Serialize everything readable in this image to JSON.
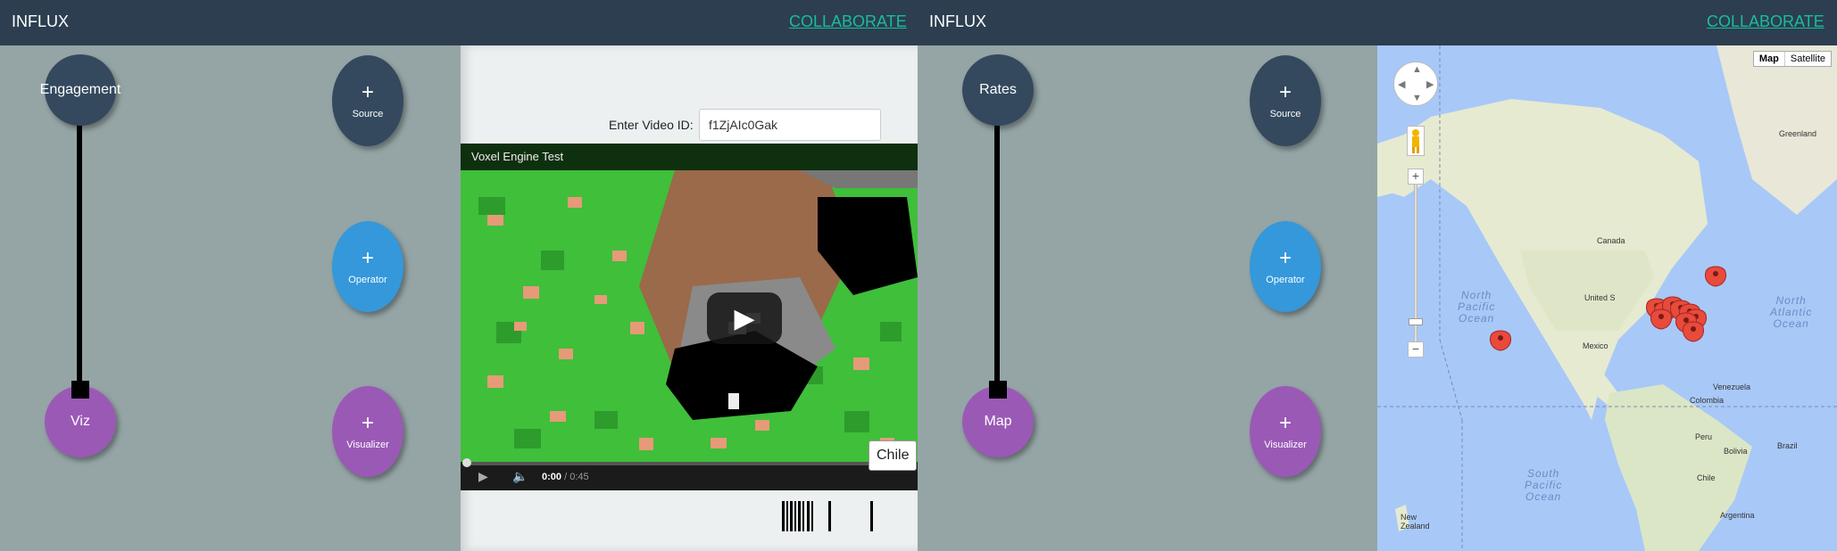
{
  "left_app": {
    "brand": "INFLUX",
    "collaborate": "COLLABORATE",
    "nodes": {
      "source": "Engagement",
      "viz": "Viz"
    },
    "add_buttons": {
      "plus": "+",
      "source": "Source",
      "operator": "Operator",
      "visualizer": "Visualizer"
    },
    "video_panel": {
      "label": "Enter Video ID:",
      "video_id": "f1ZjAIc0Gak",
      "title": "Voxel Engine Test",
      "time_current": "0:00",
      "time_total": " / 0:45",
      "tooltip": "Chile"
    }
  },
  "right_app": {
    "brand": "INFLUX",
    "collaborate": "COLLABORATE",
    "nodes": {
      "source": "Rates",
      "viz": "Map"
    },
    "add_buttons": {
      "plus": "+",
      "source": "Source",
      "operator": "Operator",
      "visualizer": "Visualizer"
    },
    "map": {
      "map_type": [
        "Map",
        "Satellite"
      ],
      "zoom_in": "+",
      "zoom_out": "−",
      "oceans": [
        {
          "name": "North Pacific Ocean",
          "lines": [
            "North",
            "Pacific",
            "Ocean"
          ]
        },
        {
          "name": "North Atlantic Ocean",
          "lines": [
            "North",
            "Atlantic",
            "Ocean"
          ]
        },
        {
          "name": "South Pacific Ocean",
          "lines": [
            "South",
            "Pacific",
            "Ocean"
          ]
        }
      ],
      "places": [
        "Greenland",
        "Canada",
        "United S",
        "Mexico",
        "Venezuela",
        "Colombia",
        "Peru",
        "Bolivia",
        "Brazil",
        "Chile",
        "Argentina",
        "New Zealand"
      ]
    }
  },
  "colors": {
    "navbar": "#2c3e50",
    "workspace": "#95a5a6",
    "accent": "#1abc9c",
    "node_dark": "#34495e",
    "node_blue": "#3498db",
    "node_purple": "#9b59b6",
    "marker": "#e84a3c"
  }
}
